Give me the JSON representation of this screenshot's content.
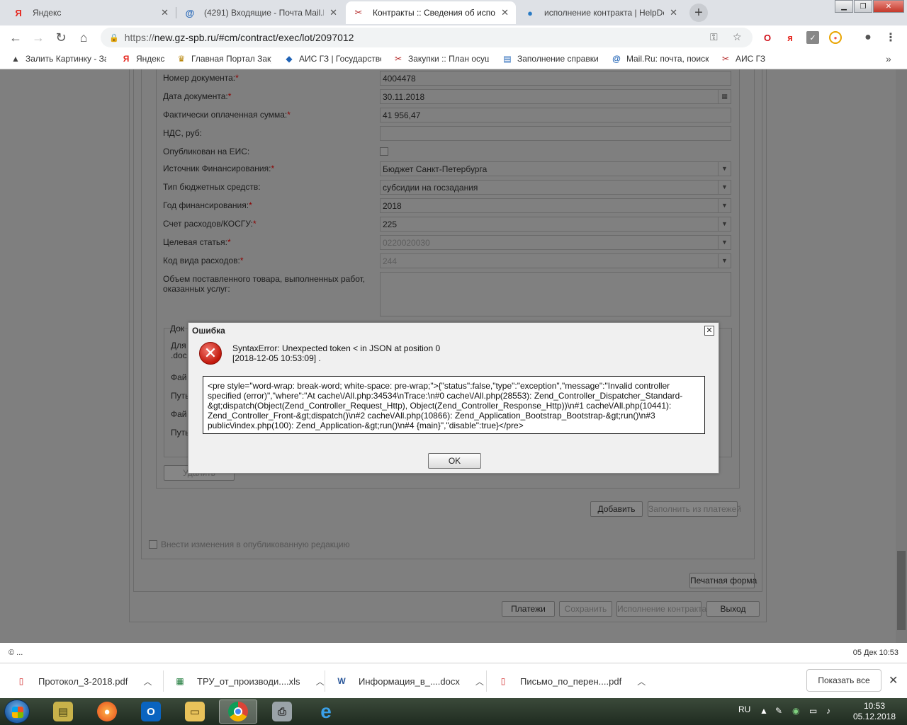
{
  "browser": {
    "tabs": [
      {
        "label": "Яндекс",
        "icon": "yandex-icon"
      },
      {
        "label": "(4291) Входящие - Почта Mail.Ru",
        "icon": "mailru-icon"
      },
      {
        "label": "Контракты :: Сведения об испол",
        "icon": "gz-icon"
      },
      {
        "label": "исполнение контракта | HelpDe",
        "icon": "helpdesk-icon"
      }
    ],
    "url_scheme": "https://",
    "url_host": "new.gz-spb.ru",
    "url_path": "/#cm/contract/exec/lot/2097012",
    "bookmarks": [
      {
        "label": "Залить Картинку - За"
      },
      {
        "label": "Яндекс"
      },
      {
        "label": "Главная Портал Заку"
      },
      {
        "label": "АИС ГЗ | Государстве"
      },
      {
        "label": "Закупки :: План осущ"
      },
      {
        "label": "Заполнение справки"
      },
      {
        "label": "Mail.Ru: почта, поиск"
      },
      {
        "label": "АИС ГЗ"
      }
    ]
  },
  "form": {
    "doc_number_label": "Номер документа:",
    "doc_number_value": "4004478",
    "doc_date_label": "Дата документа:",
    "doc_date_value": "30.11.2018",
    "paid_sum_label": "Фактически оплаченная сумма:",
    "paid_sum_value": "41 956,47",
    "vat_label": "НДС, руб:",
    "vat_value": "",
    "published_label": "Опубликован на ЕИС:",
    "funding_source_label": "Источник Финансирования:",
    "funding_source_value": "Бюджет Санкт-Петербурга",
    "budget_type_label": "Тип бюджетных средств:",
    "budget_type_value": "субсидии на госзадания",
    "funding_year_label": "Год финансирования:",
    "funding_year_value": "2018",
    "account_label": "Счет расходов/КОСГУ:",
    "account_value": "225",
    "target_article_label": "Целевая статья:",
    "target_article_value": "0220020030",
    "expense_code_label": "Код вида расходов:",
    "expense_code_value": "244",
    "volume_label_1": "Объем поставленного товара, выполненных работ,",
    "volume_label_2": "оказанных услуг:",
    "required_mark": "*"
  },
  "obscured": {
    "group_legend": "Док",
    "row1a": "Для",
    "row1b": ".doc",
    "row2": "Фай",
    "row3": "Путь",
    "row4": "Фай",
    "row5": "Путь",
    "delete_button": "Удалить"
  },
  "buttons": {
    "add": "Добавить",
    "fill_from_payments": "Заполнить из платежей",
    "print_form": "Печатная форма",
    "payments": "Платежи",
    "save": "Сохранить",
    "contract_execution": "Исполнение контракта",
    "exit": "Выход"
  },
  "publish_changes_label": "Внести изменения в опубликованную редакцию",
  "status": {
    "copyright": "© ...",
    "datetime": "05 Дек 10:53"
  },
  "dialog": {
    "title": "Ошибка",
    "message_line1": "SyntaxError: Unexpected token < in JSON at position 0",
    "message_line2": "[2018-12-05 10:53:09] .",
    "detail": "<pre style=\"word-wrap: break-word; white-space: pre-wrap;\">{\"status\":false,\"type\":\"exception\",\"message\":\"Invalid controller specified (error)\",\"where\":\"At cache\\/All.php:34534\\nTrace:\\n#0 cache\\/All.php(28553): Zend_Controller_Dispatcher_Standard-&gt;dispatch(Object(Zend_Controller_Request_Http), Object(Zend_Controller_Response_Http))\\n#1 cache\\/All.php(10441): Zend_Controller_Front-&gt;dispatch()\\n#2 cache\\/All.php(10866): Zend_Application_Bootstrap_Bootstrap-&gt;run()\\n#3 public\\/index.php(100): Zend_Application-&gt;run()\\n#4 {main}\",\"disable\":true}</pre>",
    "ok": "OK"
  },
  "downloads": {
    "items": [
      {
        "name": "Протокол_3-2018.pdf",
        "icon": "pdf-icon"
      },
      {
        "name": "ТРУ_от_производи....xls",
        "icon": "excel-icon"
      },
      {
        "name": "Информация_в_....docx",
        "icon": "word-icon"
      },
      {
        "name": "Письмо_по_перен....pdf",
        "icon": "pdf-icon"
      }
    ],
    "show_all": "Показать все"
  },
  "taskbar": {
    "lang": "RU",
    "time": "10:53",
    "date": "05.12.2018"
  },
  "colors": {
    "tab_bar": "#dee1e6",
    "overlay_gray": "#7f7f7f",
    "dialog_bg": "#f0f0f0",
    "required": "#8b0000",
    "error_red": "#c1170b"
  }
}
